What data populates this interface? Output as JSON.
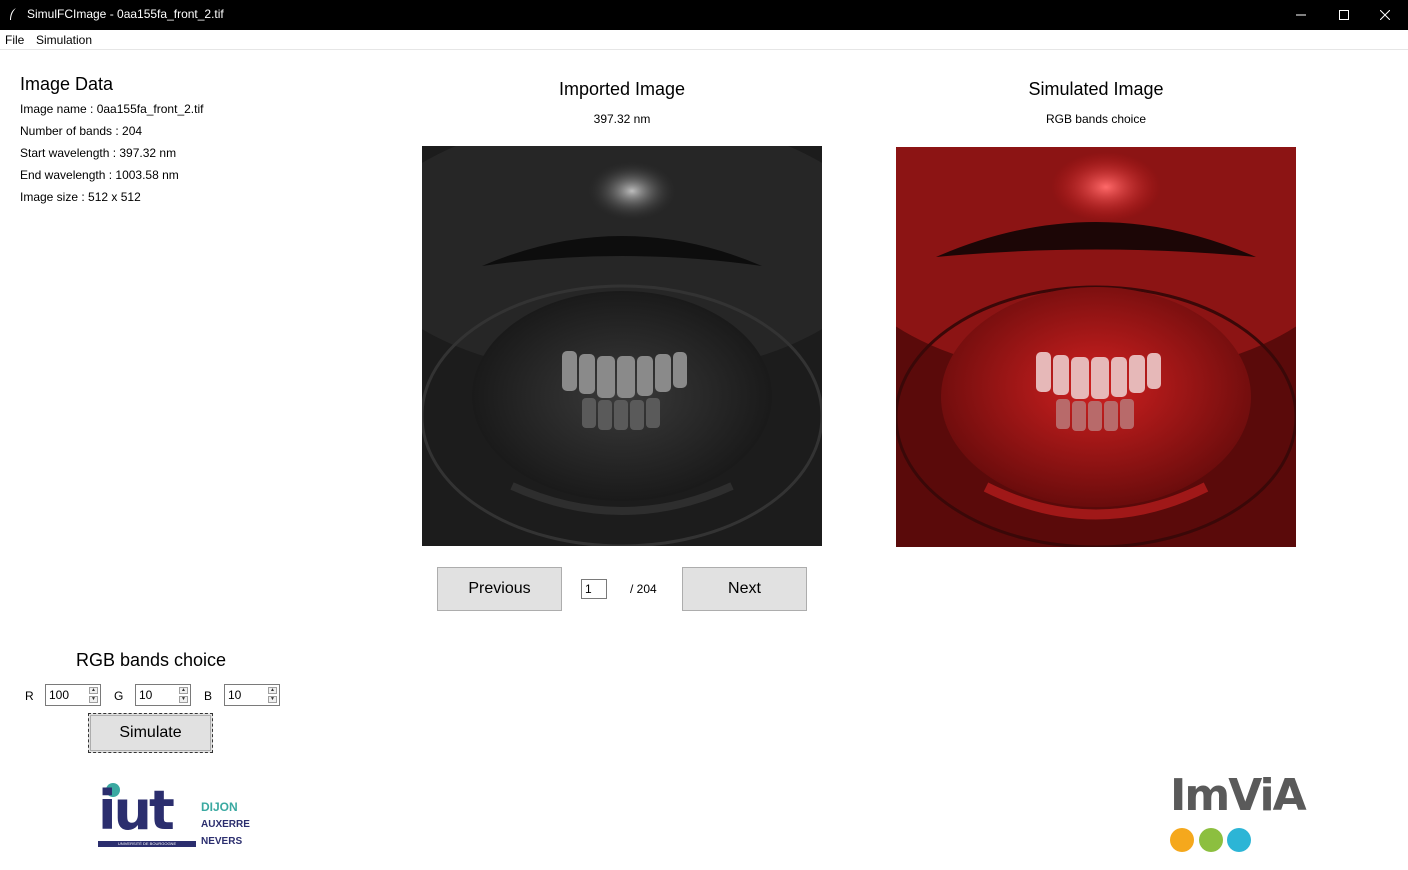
{
  "window": {
    "title": "SimulFCImage - 0aa155fa_front_2.tif"
  },
  "menu": {
    "items": [
      "File",
      "Simulation"
    ]
  },
  "image_data": {
    "heading": "Image Data",
    "lines": [
      "Image name : 0aa155fa_front_2.tif",
      "Number of bands : 204",
      "Start wavelength : 397.32 nm",
      "End wavelength : 1003.58 nm",
      "Image size : 512 x 512"
    ]
  },
  "imported": {
    "title": "Imported Image",
    "subtitle": "397.32 nm"
  },
  "simulated": {
    "title": "Simulated Image",
    "subtitle": "RGB bands choice"
  },
  "nav": {
    "previous_label": "Previous",
    "page_value": "1",
    "page_total": "/ 204",
    "next_label": "Next"
  },
  "rgb": {
    "heading": "RGB bands choice",
    "r_label": "R",
    "r_value": "100",
    "g_label": "G",
    "g_value": "10",
    "b_label": "B",
    "b_value": "10",
    "simulate_label": "Simulate"
  },
  "logos": {
    "iut_text": "iut",
    "iut_sub": "UNIVERSITÉ DE BOURGOGNE",
    "iut_cities": [
      "DIJON",
      "AUXERRE",
      "NEVERS"
    ],
    "imvia_text": "ImViA",
    "imvia_dot_colors": [
      "#f5a81c",
      "#8cbf3f",
      "#2cb5d6"
    ]
  },
  "colors": {
    "titlebar_bg": "#000000",
    "button_bg": "#e1e1e1",
    "iut_navy": "#2b2e6e",
    "iut_teal": "#3aa9a1",
    "imvia_gray": "#5a5a5a"
  }
}
